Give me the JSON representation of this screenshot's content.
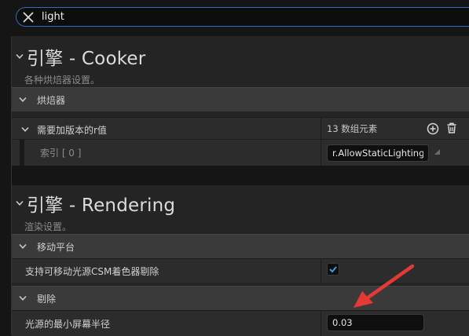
{
  "search": {
    "value": "light",
    "clear_icon": "close-icon"
  },
  "sections": [
    {
      "title": "引擎 - Cooker",
      "description": "各种烘焙器设置。",
      "category": "烘焙器",
      "array_property": {
        "label": "需要加版本的r值",
        "count_text": "13 数组元素",
        "add_icon": "plus-circle-icon",
        "delete_icon": "trash-icon",
        "element": {
          "index_label": "索引 [ 0 ]",
          "value": "r.AllowStaticLighting"
        }
      }
    },
    {
      "title": "引擎 - Rendering",
      "description": "渲染设置。",
      "categories": [
        {
          "label": "移动平台",
          "property": {
            "label": "支持可移动光源CSM着色器剔除",
            "checked": true
          }
        },
        {
          "label": "剔除",
          "property": {
            "label": "光源的最小屏幕半径",
            "value": "0.03"
          }
        }
      ]
    }
  ],
  "colors": {
    "accent": "#2a73b6",
    "checkbox_check": "#3a9ee0",
    "annotation_arrow": "#e53935"
  }
}
